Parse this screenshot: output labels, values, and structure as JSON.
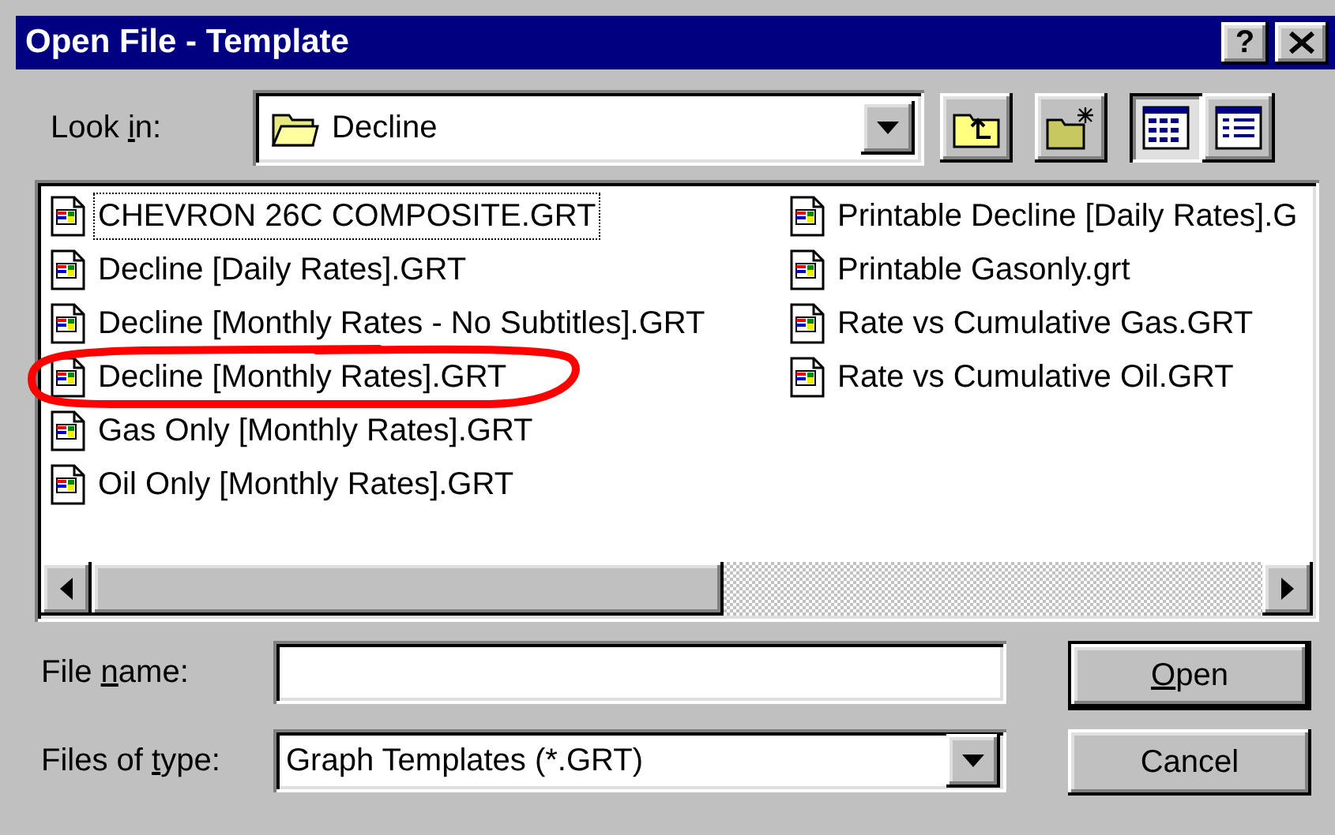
{
  "window": {
    "title": "Open File - Template",
    "help_button": "?"
  },
  "look_in": {
    "label_parts": [
      {
        "text": "Look ",
        "underlined": false
      },
      {
        "text": "i",
        "underlined": true
      },
      {
        "text": "n:",
        "underlined": false
      }
    ],
    "value": "Decline"
  },
  "toolbar": [
    {
      "kind": "up-folder",
      "selected": false
    },
    {
      "kind": "new-folder",
      "selected": false
    },
    {
      "kind": "list-view",
      "selected": true
    },
    {
      "kind": "details-view",
      "selected": false
    }
  ],
  "files": [
    {
      "name": "CHEVRON 26C COMPOSITE.GRT",
      "focused": true
    },
    {
      "name": "Decline [Daily Rates].GRT",
      "focused": false
    },
    {
      "name": "Decline [Monthly Rates - No Subtitles].GRT",
      "focused": false
    },
    {
      "name": "Decline [Monthly Rates].GRT",
      "focused": false
    },
    {
      "name": "Gas Only [Monthly Rates].GRT",
      "focused": false
    },
    {
      "name": "Oil Only [Monthly Rates].GRT",
      "focused": false
    },
    {
      "name": "Printable Decline [Daily Rates].G",
      "focused": false
    },
    {
      "name": "Printable Gasonly.grt",
      "focused": false
    },
    {
      "name": "Rate vs Cumulative Gas.GRT",
      "focused": false
    },
    {
      "name": "Rate vs Cumulative Oil.GRT",
      "focused": false
    }
  ],
  "file_name": {
    "label_parts": [
      {
        "text": "File ",
        "underlined": false
      },
      {
        "text": "n",
        "underlined": true
      },
      {
        "text": "ame:",
        "underlined": false
      }
    ]
  },
  "file_type": {
    "label_parts": [
      {
        "text": "Files of ",
        "underlined": false
      },
      {
        "text": "t",
        "underlined": true
      },
      {
        "text": "ype:",
        "underlined": false
      }
    ],
    "value": "Graph Templates (*.GRT)"
  },
  "buttons": [
    {
      "label_parts": [
        {
          "text": "O",
          "underlined": true
        },
        {
          "text": "pen",
          "underlined": false
        }
      ],
      "default": true
    },
    {
      "label_parts": [
        {
          "text": "Cancel",
          "underlined": false
        }
      ],
      "default": false
    }
  ],
  "annotation": {
    "kind": "freehand-circle"
  }
}
